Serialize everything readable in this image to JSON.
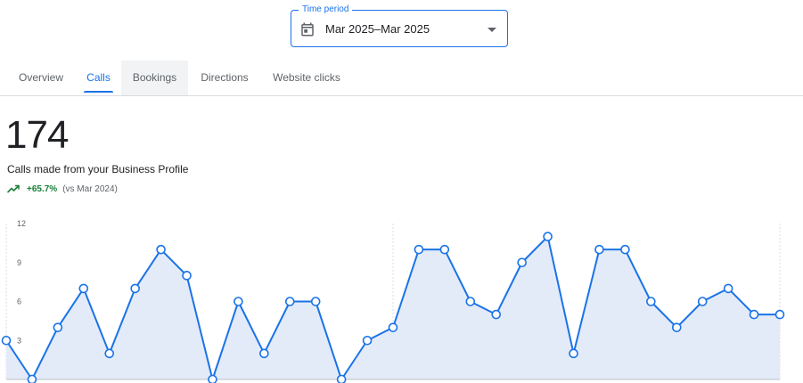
{
  "period": {
    "legend": "Time period",
    "value": "Mar 2025–Mar 2025",
    "icon": "calendar-icon"
  },
  "tabs": [
    {
      "label": "Overview",
      "active": false
    },
    {
      "label": "Calls",
      "active": true
    },
    {
      "label": "Bookings",
      "active": false
    },
    {
      "label": "Directions",
      "active": false
    },
    {
      "label": "Website clicks",
      "active": false
    }
  ],
  "metric": {
    "value": "174",
    "label": "Calls made from your Business Profile",
    "change": "+65.7%",
    "comparison": "(vs Mar 2024)",
    "trend_icon": "trending-up-icon"
  },
  "colors": {
    "accent": "#1a73e8",
    "positive": "#188038",
    "area_fill": "#e3ebf9"
  },
  "chart_data": {
    "type": "area",
    "ylim": [
      0,
      12
    ],
    "yticks": [
      "3",
      "6",
      "9",
      "12"
    ],
    "values": [
      3,
      0,
      4,
      7,
      2,
      7,
      10,
      8,
      0,
      6,
      2,
      6,
      6,
      0,
      3,
      4,
      10,
      10,
      6,
      5,
      9,
      11,
      2,
      10,
      10,
      6,
      4,
      6,
      7,
      5,
      5
    ]
  }
}
